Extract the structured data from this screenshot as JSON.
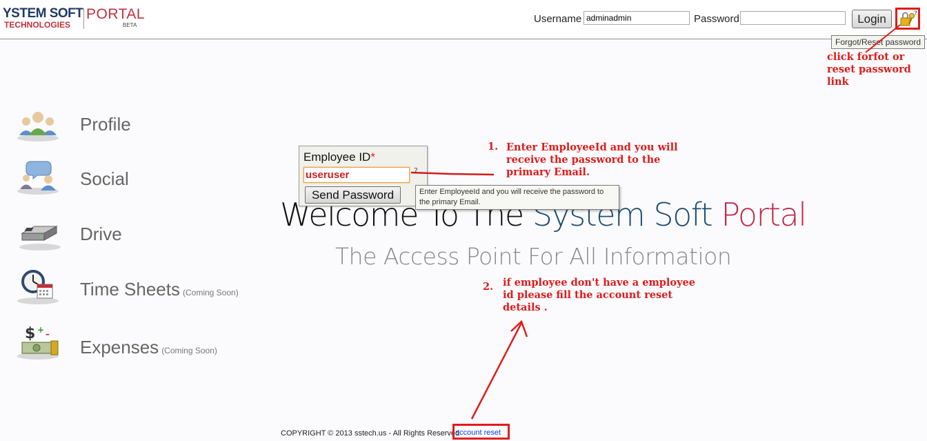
{
  "header": {
    "logo_main": "YSTEM SOFT",
    "logo_sub": "TECHNOLOGIES",
    "logo_portal": "PORTAL",
    "logo_beta": "BETA",
    "username_label": "Username",
    "username_value": "adminadmin",
    "password_label": "Password",
    "password_value": "",
    "login_label": "Login",
    "forgot_icon": "key-lock-icon",
    "forgot_tooltip": "Forgot/Reset password"
  },
  "sidebar": {
    "items": [
      {
        "label": "Profile",
        "suffix": "",
        "icon": "profile-people-icon"
      },
      {
        "label": "Social",
        "suffix": "",
        "icon": "social-chat-icon"
      },
      {
        "label": "Drive",
        "suffix": "",
        "icon": "drive-icon"
      },
      {
        "label": "Time Sheets",
        "suffix": "(Coming Soon)",
        "icon": "clock-calendar-icon"
      },
      {
        "label": "Expenses",
        "suffix": "(Coming Soon)",
        "icon": "money-icon"
      }
    ]
  },
  "main": {
    "welcome_part1": "Welcome To The ",
    "welcome_part2": "System Soft ",
    "welcome_part3": "Portal",
    "tagline": "The Access Point For All Information"
  },
  "popup": {
    "label": "Employee ID",
    "required_mark": "*",
    "value": "useruser",
    "help": "?",
    "button_label": "Send Password",
    "tooltip": "Enter EmployeeId and you will receive the password to the primary Email."
  },
  "annotations": {
    "forgot": "click forfot or reset password link",
    "step1_num": "1.",
    "step1": "Enter EmployeeId and you will receive the password to the primary Email.",
    "step2_num": "2.",
    "step2": "if employee don't have a employee id please fill the account reset details ."
  },
  "footer": {
    "copyright": "COPYRIGHT © 2013 sstech.us - All Rights Reserved",
    "account_reset": "account reset"
  },
  "colors": {
    "annotation": "#e01b1b",
    "brand_blue": "#1f4f72",
    "brand_red": "#c22a4a",
    "link": "#1a3fcf"
  }
}
